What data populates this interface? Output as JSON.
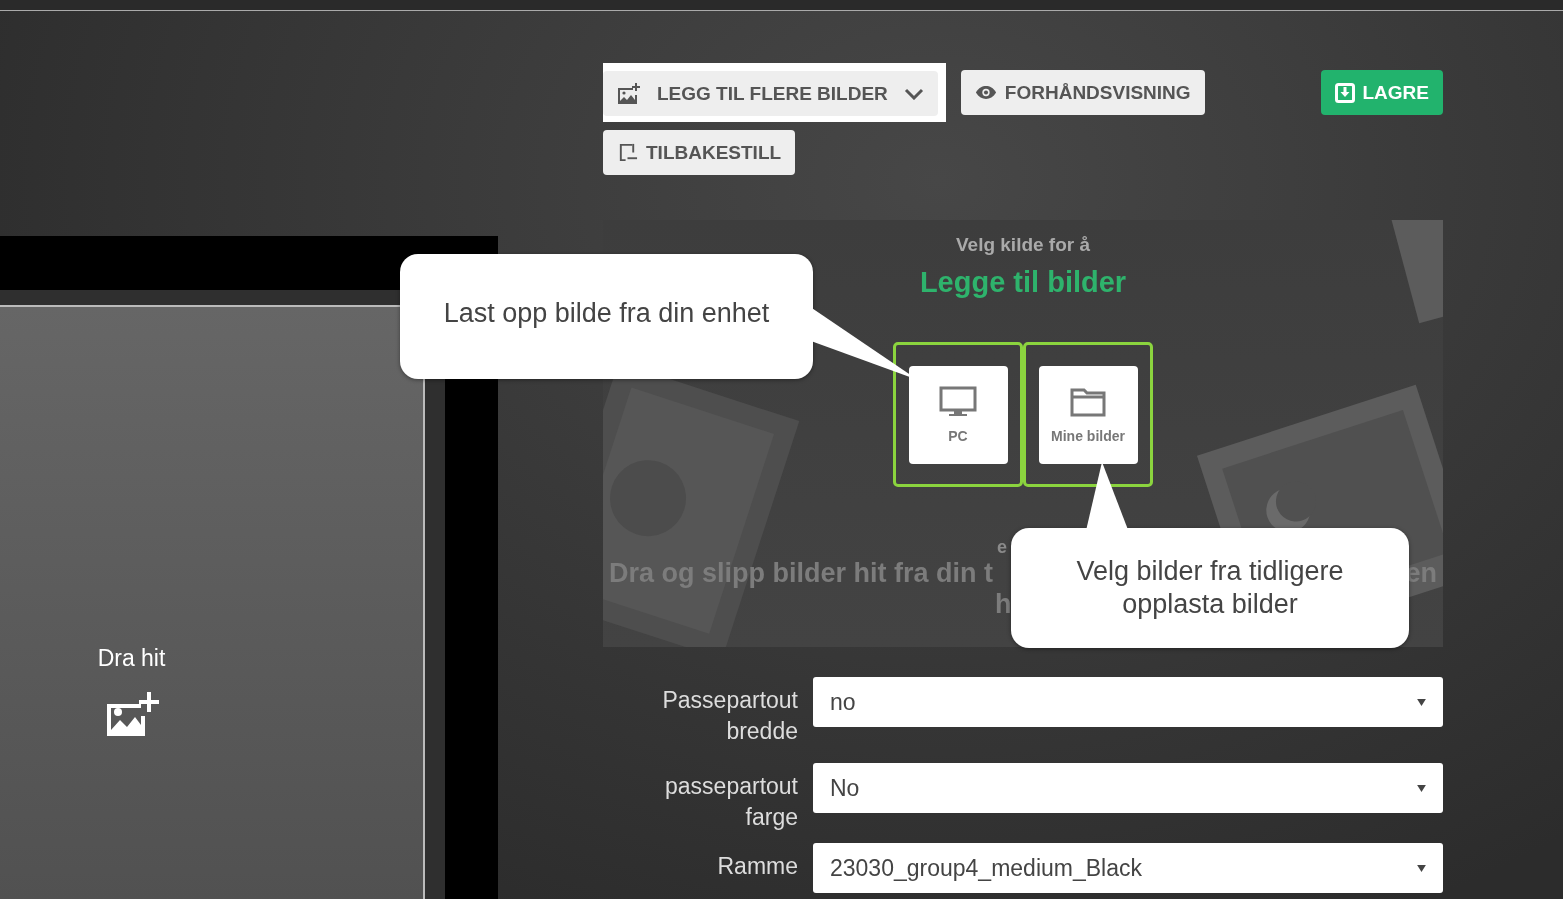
{
  "toolbar": {
    "add_images": {
      "label": "LEGG TIL FLERE BILDER",
      "highlighted": true
    },
    "preview": {
      "label": "FORHÅNDSVISNING"
    },
    "save": {
      "label": "LAGRE"
    },
    "reset": {
      "label": "TILBAKESTILL"
    }
  },
  "drop_zone": {
    "label": "Dra hit"
  },
  "source_picker": {
    "subtitle": "Velg kilde for å",
    "title": "Legge til bilder",
    "sources": [
      {
        "label": "PC",
        "kind": "monitor",
        "highlighted": true
      },
      {
        "label": "Mine bilder",
        "kind": "folder",
        "highlighted": true
      }
    ],
    "drop_hint": {
      "line_1_fragment": "e",
      "line_2_left": "Dra og slipp bilder hit fra din t",
      "line_2_right": "en",
      "line_3_fragment": "h"
    }
  },
  "callouts": [
    {
      "text": "Last opp bilde fra din enhet"
    },
    {
      "text": "Velg bilder fra tidligere opplasta bilder"
    }
  ],
  "options": [
    {
      "label": "Passepartout bredde",
      "value": "no"
    },
    {
      "label": "passepartout farge",
      "value": "No"
    },
    {
      "label": "Ramme",
      "value": "23030_group4_medium_Black"
    }
  ]
}
